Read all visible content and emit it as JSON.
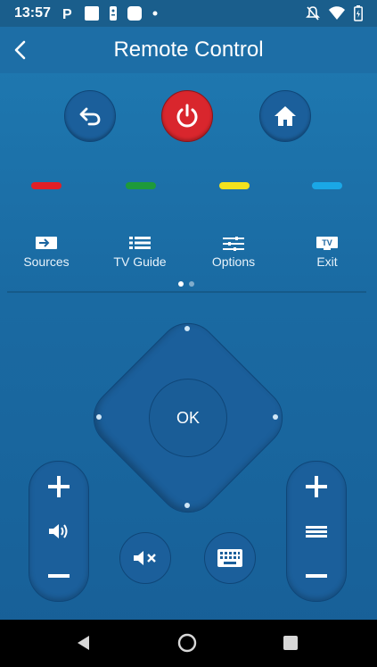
{
  "status": {
    "time": "13:57"
  },
  "appbar": {
    "title": "Remote Control"
  },
  "top_buttons": [
    "back-icon",
    "power-icon",
    "home-icon"
  ],
  "color_keys": [
    "#e21f26",
    "#1e9a3a",
    "#f2e21e",
    "#1aa7e6"
  ],
  "functions": [
    {
      "label": "Sources",
      "icon": "sources-icon"
    },
    {
      "label": "TV Guide",
      "icon": "tv-guide-icon"
    },
    {
      "label": "Options",
      "icon": "options-icon"
    },
    {
      "label": "Exit",
      "icon": "exit-tv-icon",
      "icon_text": "TV"
    }
  ],
  "pager": {
    "count": 2,
    "active": 1
  },
  "dpad": {
    "ok_label": "OK"
  },
  "volume": {
    "plus": "+",
    "minus": "−"
  },
  "channel": {
    "plus": "+",
    "minus": "−"
  },
  "colors": {
    "accent": "#1d6ea6",
    "power": "#d9262d"
  }
}
